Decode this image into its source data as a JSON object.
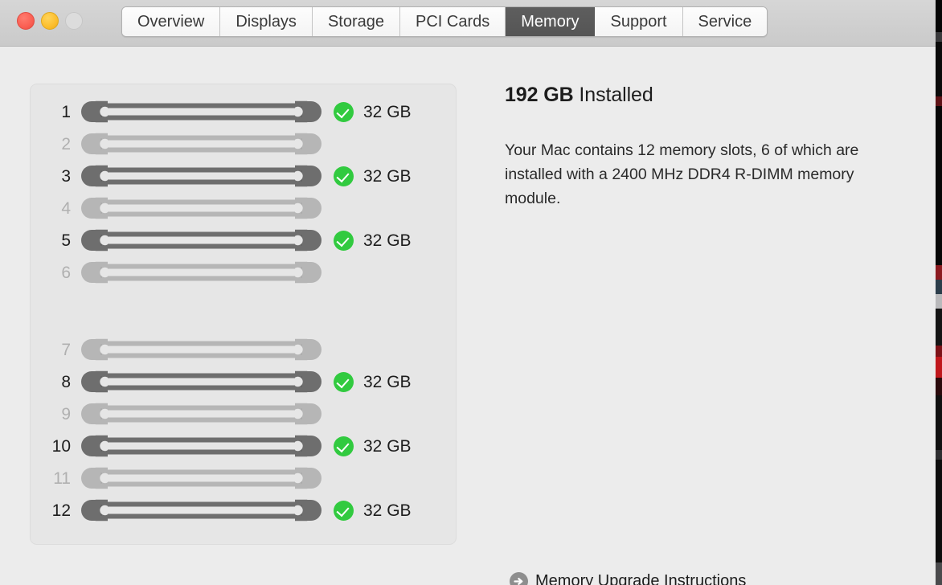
{
  "window": {
    "traffic_lights": [
      {
        "name": "close",
        "label": "Close",
        "color": "#fa5e52",
        "enabled": true
      },
      {
        "name": "minimize",
        "label": "Minimize",
        "color": "#fcbd2c",
        "enabled": true
      },
      {
        "name": "zoom",
        "label": "Zoom",
        "color": "#dcdcdc",
        "enabled": false
      }
    ]
  },
  "tabs": [
    {
      "label": "Overview",
      "selected": false
    },
    {
      "label": "Displays",
      "selected": false
    },
    {
      "label": "Storage",
      "selected": false
    },
    {
      "label": "PCI Cards",
      "selected": false
    },
    {
      "label": "Memory",
      "selected": true
    },
    {
      "label": "Support",
      "selected": false
    },
    {
      "label": "Service",
      "selected": false
    }
  ],
  "memory": {
    "installed_amount": "192 GB",
    "installed_suffix": "Installed",
    "description": "Your Mac contains 12 memory slots, 6 of which are installed with a 2400 MHz DDR4 R-DIMM memory module.",
    "upgrade_link_label": "Memory Upgrade Instructions",
    "upgrade_link_icon": "arrow-right-circle-icon",
    "status_icon": "green-check-icon",
    "slot_groups": [
      {
        "slots": [
          {
            "number": "1",
            "filled": true,
            "size": "32 GB"
          },
          {
            "number": "2",
            "filled": false,
            "size": ""
          },
          {
            "number": "3",
            "filled": true,
            "size": "32 GB"
          },
          {
            "number": "4",
            "filled": false,
            "size": ""
          },
          {
            "number": "5",
            "filled": true,
            "size": "32 GB"
          },
          {
            "number": "6",
            "filled": false,
            "size": ""
          }
        ]
      },
      {
        "slots": [
          {
            "number": "7",
            "filled": false,
            "size": ""
          },
          {
            "number": "8",
            "filled": true,
            "size": "32 GB"
          },
          {
            "number": "9",
            "filled": false,
            "size": ""
          },
          {
            "number": "10",
            "filled": true,
            "size": "32 GB"
          },
          {
            "number": "11",
            "filled": false,
            "size": ""
          },
          {
            "number": "12",
            "filled": true,
            "size": "32 GB"
          }
        ]
      }
    ]
  },
  "colors": {
    "dimm_filled": "#6e6e6e",
    "dimm_empty": "#b6b6b6",
    "status_green": "#31ca3f",
    "panel_bg": "#e6e6e6",
    "window_bg": "#ececec",
    "titlebar_bg": "#cdcdcd",
    "tab_selected_bg": "#585858"
  }
}
